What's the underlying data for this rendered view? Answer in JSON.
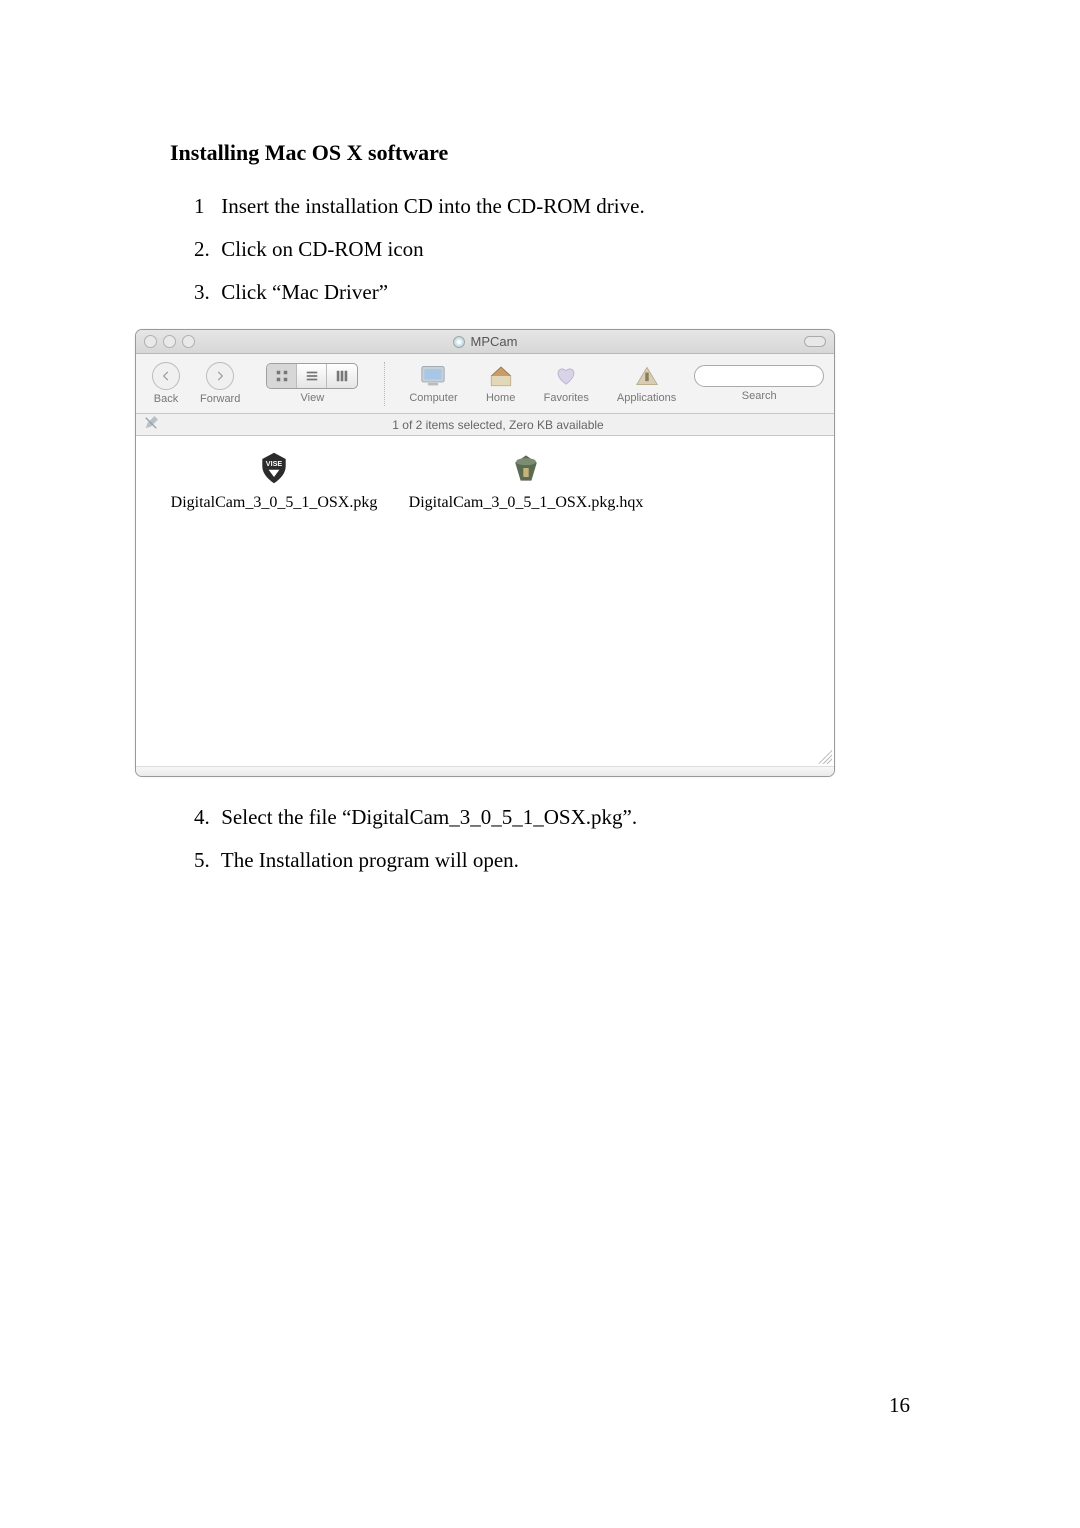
{
  "page": {
    "heading": "Installing Mac OS X software",
    "steps_top": [
      {
        "num": "1",
        "text": "Insert the installation CD into the CD-ROM drive."
      },
      {
        "num": "2.",
        "text": "Click on CD-ROM icon"
      },
      {
        "num": "3.",
        "text": "Click “Mac Driver”"
      }
    ],
    "steps_bottom": [
      {
        "num": "4.",
        "text": "Select the file “DigitalCam_3_0_5_1_OSX.pkg”."
      },
      {
        "num": "5.",
        "text": " The Installation program will open."
      }
    ],
    "page_number": "16"
  },
  "finder": {
    "window_title": "MPCam",
    "toolbar": {
      "back": "Back",
      "forward": "Forward",
      "view": "View",
      "computer": "Computer",
      "home": "Home",
      "favorites": "Favorites",
      "applications": "Applications",
      "search": "Search"
    },
    "status": "1 of 2 items selected, Zero KB available",
    "files": [
      {
        "name": "DigitalCam_3_0_5_1_OSX.pkg"
      },
      {
        "name": "DigitalCam_3_0_5_1_OSX.pkg.hqx"
      }
    ]
  }
}
